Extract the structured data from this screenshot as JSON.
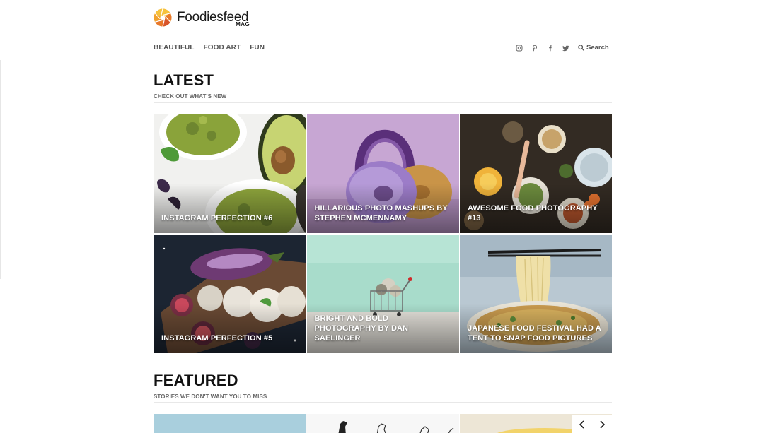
{
  "brand": {
    "name": "Foodiesfeed",
    "sub": "MAG",
    "colors": [
      "#f2a12c",
      "#e8782a",
      "#d8552b",
      "#f6c23c"
    ]
  },
  "nav": {
    "items": [
      {
        "label": "BEAUTIFUL"
      },
      {
        "label": "FOOD ART"
      },
      {
        "label": "FUN"
      }
    ]
  },
  "social": {
    "icons": [
      "instagram-icon",
      "pinterest-icon",
      "facebook-icon",
      "twitter-icon"
    ],
    "search_label": "Search"
  },
  "latest": {
    "title": "LATEST",
    "subtitle": "CHECK OUT WHAT'S NEW",
    "cards": [
      {
        "title": "INSTAGRAM PERFECTION #6"
      },
      {
        "title": "HILLARIOUS PHOTO MASHUPS BY STEPHEN MCMENNAMY"
      },
      {
        "title": "AWESOME FOOD PHOTOGRAPHY #13"
      },
      {
        "title": "INSTAGRAM PERFECTION #5"
      },
      {
        "title": "BRIGHT AND BOLD PHOTOGRAPHY BY DAN SAELINGER"
      },
      {
        "title": "JAPANESE FOOD FESTIVAL HAD A TENT TO SNAP FOOD PICTURES"
      }
    ]
  },
  "featured": {
    "title": "FEATURED",
    "subtitle": "STORIES WE DON'T WANT YOU TO MISS",
    "prev_icon": "chevron-left-icon",
    "next_icon": "chevron-right-icon"
  }
}
